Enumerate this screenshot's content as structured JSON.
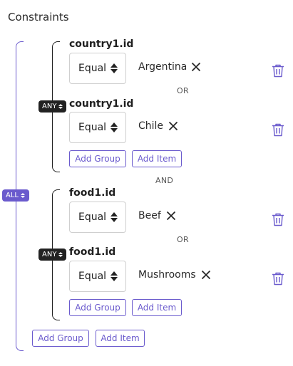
{
  "title": "Constraints",
  "root": {
    "logic": "ALL",
    "add_group": "Add Group",
    "add_item": "Add Item",
    "separator": "AND"
  },
  "groups": [
    {
      "logic": "ANY",
      "separator": "OR",
      "add_group": "Add Group",
      "add_item": "Add Item",
      "items": [
        {
          "field": "country1.id",
          "operator": "Equal",
          "value": "Argentina"
        },
        {
          "field": "country1.id",
          "operator": "Equal",
          "value": "Chile"
        }
      ]
    },
    {
      "logic": "ANY",
      "separator": "OR",
      "add_group": "Add Group",
      "add_item": "Add Item",
      "items": [
        {
          "field": "food1.id",
          "operator": "Equal",
          "value": "Beef"
        },
        {
          "field": "food1.id",
          "operator": "Equal",
          "value": "Mushrooms"
        }
      ]
    }
  ],
  "colors": {
    "accent": "#6a5acd",
    "badge_dark": "#222222"
  },
  "icons": {
    "remove": "close-icon",
    "delete": "trash-icon",
    "sort": "up-down-arrows-icon"
  }
}
